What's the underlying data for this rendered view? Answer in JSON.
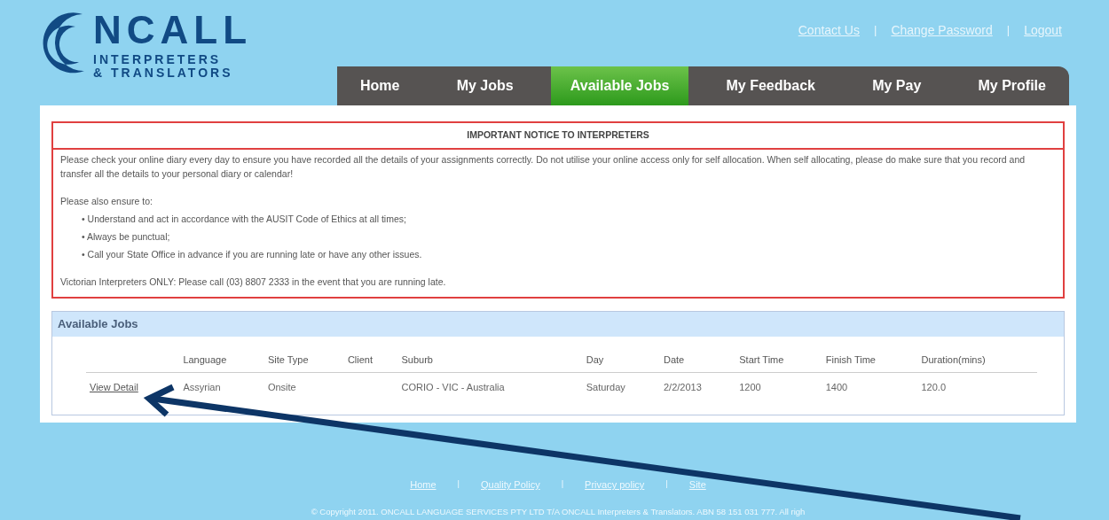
{
  "logo": {
    "wordmark": "NCALL",
    "line_1": "INTERPRETERS",
    "line_2": "& TRANSLATORS"
  },
  "top_links": [
    {
      "kind": "link",
      "text": "Contact Us"
    },
    {
      "kind": "separator",
      "text": "|"
    },
    {
      "kind": "link",
      "text": "Change Password"
    },
    {
      "kind": "separator",
      "text": "|"
    },
    {
      "kind": "link",
      "text": "Logout"
    }
  ],
  "tabs": [
    {
      "label": "Home",
      "selected": false
    },
    {
      "label": "My Jobs",
      "selected": false
    },
    {
      "label": "Available Jobs",
      "selected": true
    },
    {
      "label": "My Feedback",
      "selected": false
    },
    {
      "label": "My Pay",
      "selected": false
    },
    {
      "label": "My Profile",
      "selected": false
    }
  ],
  "notice": {
    "title": "IMPORTANT NOTICE TO INTERPRETERS",
    "paragraph": "Please check your online diary every day to ensure you have recorded all the details of your assignments correctly. Do not utilise your online access only for self allocation. When self allocating, please do make sure that you record and transfer all the details to your personal diary or calendar!",
    "intro": "Please also ensure to:",
    "bullets": [
      "• Understand and act in accordance with the AUSIT Code of Ethics at all times;",
      "• Always be punctual;",
      "• Call your State Office in advance if you are running late or have any other issues."
    ],
    "footer": "Victorian Interpreters ONLY: Please call (03) 8807 2333 in the event that you are running late."
  },
  "jobs": {
    "title": "Available Jobs",
    "columns": [
      "Language",
      "Site Type",
      "Client",
      "Suburb",
      "Day",
      "Date",
      "Start Time",
      "Finish Time",
      "Duration(mins)"
    ],
    "rows": [
      {
        "link": "View Detail",
        "cells": [
          "Assyrian",
          "Onsite",
          "",
          "CORIO - VIC - Australia",
          "Saturday",
          "2/2/2013",
          "1200",
          "1400",
          "120.0"
        ]
      }
    ]
  },
  "footer": {
    "links": [
      {
        "kind": "link",
        "text": "Home"
      },
      {
        "kind": "separator",
        "text": "|"
      },
      {
        "kind": "link",
        "text": "Quality Policy"
      },
      {
        "kind": "separator",
        "text": "|"
      },
      {
        "kind": "link",
        "text": "Privacy policy"
      },
      {
        "kind": "separator",
        "text": "|"
      },
      {
        "kind": "link",
        "text": "Site"
      }
    ],
    "copyright": "© Copyright 2011. ONCALL LANGUAGE SERVICES PTY LTD T/A ONCALL Interpreters & Translators. ABN 58 151 031 777. All righ"
  }
}
